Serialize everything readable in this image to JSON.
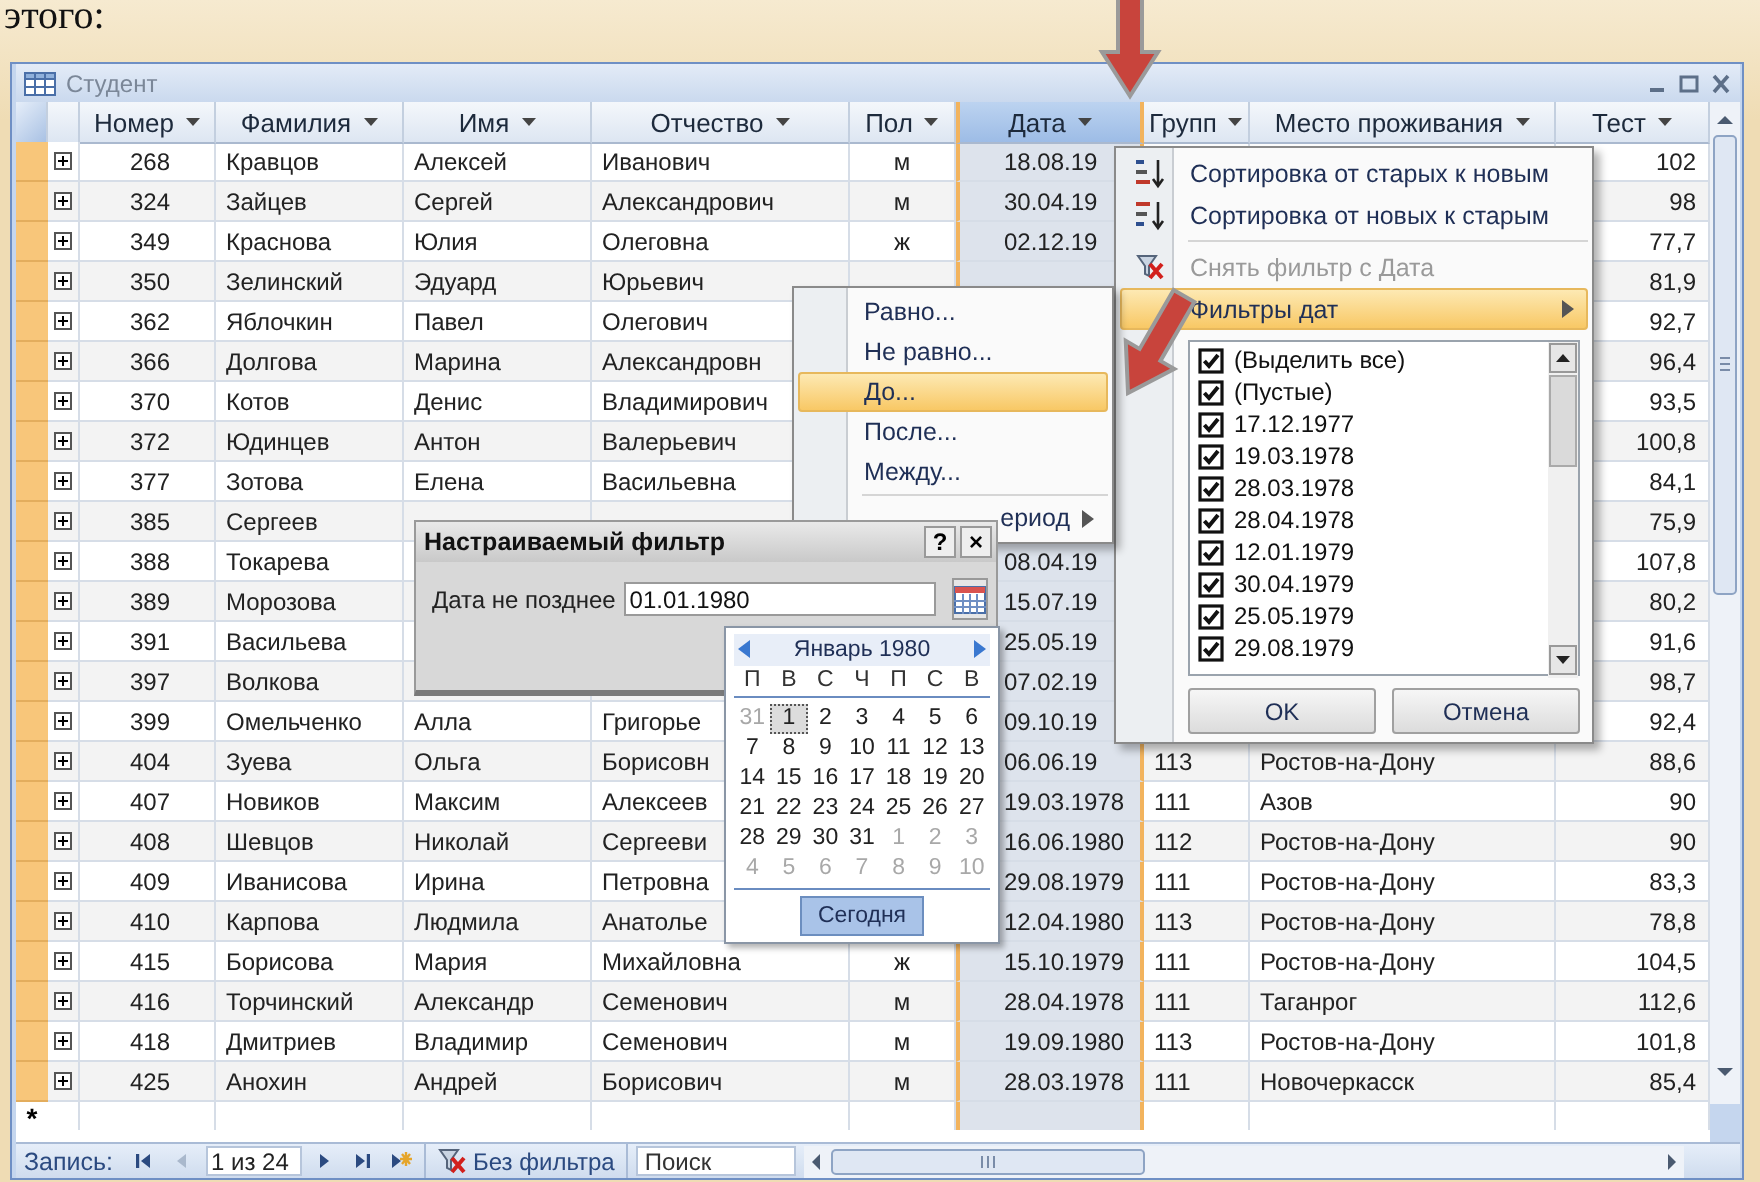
{
  "caption": "этого:",
  "window": {
    "title": "Студент"
  },
  "table": {
    "columns": [
      {
        "label": "Номер",
        "selected": false
      },
      {
        "label": "Фамилия",
        "selected": false
      },
      {
        "label": "Имя",
        "selected": false
      },
      {
        "label": "Отчество",
        "selected": false
      },
      {
        "label": "Пол",
        "selected": false
      },
      {
        "label": "Дата",
        "selected": true
      },
      {
        "label": "Групп",
        "selected": false
      },
      {
        "label": "Место проживания",
        "selected": false
      },
      {
        "label": "Тест",
        "selected": false
      }
    ],
    "rows": [
      {
        "cells": [
          "268",
          "Кравцов",
          "Алексей",
          "Иванович",
          "м",
          "18.08.19",
          null,
          null,
          "102"
        ]
      },
      {
        "cells": [
          "324",
          "Зайцев",
          "Сергей",
          "Александрович",
          "м",
          "30.04.19",
          null,
          null,
          "98"
        ]
      },
      {
        "cells": [
          "349",
          "Краснова",
          "Юлия",
          "Олеговна",
          "ж",
          "02.12.19",
          null,
          null,
          "77,7"
        ]
      },
      {
        "cells": [
          "350",
          "Зелинский",
          "Эдуард",
          "Юрьевич",
          null,
          null,
          null,
          null,
          "81,9"
        ]
      },
      {
        "cells": [
          "362",
          "Яблочкин",
          "Павел",
          "Олегович",
          null,
          null,
          null,
          null,
          "92,7"
        ]
      },
      {
        "cells": [
          "366",
          "Долгова",
          "Марина",
          "Александровн",
          null,
          null,
          null,
          null,
          "96,4"
        ]
      },
      {
        "cells": [
          "370",
          "Котов",
          "Денис",
          "Владимирович",
          null,
          null,
          null,
          null,
          "93,5"
        ]
      },
      {
        "cells": [
          "372",
          "Юдинцев",
          "Антон",
          "Валерьевич",
          null,
          null,
          null,
          null,
          "100,8"
        ]
      },
      {
        "cells": [
          "377",
          "Зотова",
          "Елена",
          "Васильевна",
          null,
          null,
          null,
          null,
          "84,1"
        ]
      },
      {
        "cells": [
          "385",
          "Сергеев",
          null,
          null,
          null,
          null,
          null,
          null,
          "75,9"
        ]
      },
      {
        "cells": [
          "388",
          "Токарева",
          null,
          null,
          null,
          "08.04.19",
          null,
          null,
          "107,8"
        ]
      },
      {
        "cells": [
          "389",
          "Морозова",
          null,
          null,
          null,
          "15.07.19",
          null,
          null,
          "80,2"
        ]
      },
      {
        "cells": [
          "391",
          "Васильева",
          null,
          null,
          null,
          "25.05.19",
          null,
          null,
          "91,6"
        ]
      },
      {
        "cells": [
          "397",
          "Волкова",
          null,
          null,
          null,
          "07.02.19",
          null,
          null,
          "98,7"
        ]
      },
      {
        "cells": [
          "399",
          "Омельченко",
          "Алла",
          "Григорье",
          null,
          "09.10.19",
          null,
          null,
          "92,4"
        ]
      },
      {
        "cells": [
          "404",
          "Зуева",
          "Ольга",
          "Борисовн",
          null,
          "06.06.19",
          "113",
          "Ростов-на-Дону",
          "88,6"
        ]
      },
      {
        "cells": [
          "407",
          "Новиков",
          "Максим",
          "Алексеев",
          null,
          "19.03.1978",
          "111",
          "Азов",
          "90"
        ]
      },
      {
        "cells": [
          "408",
          "Шевцов",
          "Николай",
          "Сергееви",
          null,
          "16.06.1980",
          "112",
          "Ростов-на-Дону",
          "90"
        ]
      },
      {
        "cells": [
          "409",
          "Иванисова",
          "Ирина",
          "Петровна",
          null,
          "29.08.1979",
          "111",
          "Ростов-на-Дону",
          "83,3"
        ]
      },
      {
        "cells": [
          "410",
          "Карпова",
          "Людмила",
          "Анатолье",
          null,
          "12.04.1980",
          "113",
          "Ростов-на-Дону",
          "78,8"
        ]
      },
      {
        "cells": [
          "415",
          "Борисова",
          "Мария",
          "Михайловна",
          "ж",
          "15.10.1979",
          "111",
          "Ростов-на-Дону",
          "104,5"
        ]
      },
      {
        "cells": [
          "416",
          "Торчинский",
          "Александр",
          "Семенович",
          "м",
          "28.04.1978",
          "111",
          "Таганрог",
          "112,6"
        ]
      },
      {
        "cells": [
          "418",
          "Дмитриев",
          "Владимир",
          "Семенович",
          "м",
          "19.09.1980",
          "113",
          "Ростов-на-Дону",
          "101,8"
        ]
      },
      {
        "cells": [
          "425",
          "Анохин",
          "Андрей",
          "Борисович",
          "м",
          "28.03.1978",
          "111",
          "Новочеркасск",
          "85,4"
        ]
      }
    ],
    "new_row_marker": "*"
  },
  "nav": {
    "label": "Запись:",
    "position": "1 из 24",
    "buttons": [
      {
        "kind": "first",
        "disabled": false
      },
      {
        "kind": "prev",
        "disabled": true
      },
      {
        "kind": "next",
        "disabled": false
      },
      {
        "kind": "last",
        "disabled": false
      },
      {
        "kind": "new",
        "disabled": false
      }
    ],
    "filter": "Без фильтра",
    "search": {
      "placeholder": "Поиск"
    }
  },
  "column_menu": {
    "items": [
      {
        "kind": "sort-asc",
        "label": "Сортировка от старых к новым",
        "disabled": false,
        "selected": false
      },
      {
        "kind": "sort-desc",
        "label": "Сортировка от новых к старым",
        "disabled": false,
        "selected": false
      },
      {
        "kind": "clear-filter",
        "label": "Снять фильтр с Дата",
        "disabled": true,
        "selected": false
      },
      {
        "kind": "submenu",
        "label": "Фильтры дат",
        "disabled": false,
        "selected": true
      }
    ],
    "values": [
      {
        "label": "(Выделить все)",
        "checked": true
      },
      {
        "label": "(Пустые)",
        "checked": true
      },
      {
        "label": "17.12.1977",
        "checked": true
      },
      {
        "label": "19.03.1978",
        "checked": true
      },
      {
        "label": "28.03.1978",
        "checked": true
      },
      {
        "label": "28.04.1978",
        "checked": true
      },
      {
        "label": "12.01.1979",
        "checked": true
      },
      {
        "label": "30.04.1979",
        "checked": true
      },
      {
        "label": "25.05.1979",
        "checked": true
      },
      {
        "label": "29.08.1979",
        "checked": true
      }
    ],
    "buttons": [
      "OK",
      "Отмена"
    ]
  },
  "date_filters_menu": {
    "items": [
      {
        "kind": "command",
        "label": "Равно...",
        "selected": false
      },
      {
        "kind": "command",
        "label": "Не равно...",
        "selected": false
      },
      {
        "kind": "command",
        "label": "До...",
        "selected": true
      },
      {
        "kind": "command",
        "label": "После...",
        "selected": false
      },
      {
        "kind": "command",
        "label": "Между...",
        "selected": false
      },
      {
        "kind": "submenu",
        "label": "ериод",
        "selected": false
      }
    ]
  },
  "dialog": {
    "title": "Настраиваемый фильтр",
    "title_buttons": [
      "?",
      "×"
    ],
    "label": "Дата не позднее",
    "value": "01.01.1980"
  },
  "calendar": {
    "month": "Январь 1980",
    "weekdays": [
      "П",
      "В",
      "С",
      "Ч",
      "П",
      "С",
      "В"
    ],
    "weeks": [
      [
        {
          "day": "31",
          "other_month": true,
          "selected": false
        },
        {
          "day": "1",
          "other_month": false,
          "selected": true
        },
        {
          "day": "2",
          "other_month": false,
          "selected": false
        },
        {
          "day": "3",
          "other_month": false,
          "selected": false
        },
        {
          "day": "4",
          "other_month": false,
          "selected": false
        },
        {
          "day": "5",
          "other_month": false,
          "selected": false
        },
        {
          "day": "6",
          "other_month": false,
          "selected": false
        }
      ],
      [
        {
          "day": "7",
          "other_month": false,
          "selected": false
        },
        {
          "day": "8",
          "other_month": false,
          "selected": false
        },
        {
          "day": "9",
          "other_month": false,
          "selected": false
        },
        {
          "day": "10",
          "other_month": false,
          "selected": false
        },
        {
          "day": "11",
          "other_month": false,
          "selected": false
        },
        {
          "day": "12",
          "other_month": false,
          "selected": false
        },
        {
          "day": "13",
          "other_month": false,
          "selected": false
        }
      ],
      [
        {
          "day": "14",
          "other_month": false,
          "selected": false
        },
        {
          "day": "15",
          "other_month": false,
          "selected": false
        },
        {
          "day": "16",
          "other_month": false,
          "selected": false
        },
        {
          "day": "17",
          "other_month": false,
          "selected": false
        },
        {
          "day": "18",
          "other_month": false,
          "selected": false
        },
        {
          "day": "19",
          "other_month": false,
          "selected": false
        },
        {
          "day": "20",
          "other_month": false,
          "selected": false
        }
      ],
      [
        {
          "day": "21",
          "other_month": false,
          "selected": false
        },
        {
          "day": "22",
          "other_month": false,
          "selected": false
        },
        {
          "day": "23",
          "other_month": false,
          "selected": false
        },
        {
          "day": "24",
          "other_month": false,
          "selected": false
        },
        {
          "day": "25",
          "other_month": false,
          "selected": false
        },
        {
          "day": "26",
          "other_month": false,
          "selected": false
        },
        {
          "day": "27",
          "other_month": false,
          "selected": false
        }
      ],
      [
        {
          "day": "28",
          "other_month": false,
          "selected": false
        },
        {
          "day": "29",
          "other_month": false,
          "selected": false
        },
        {
          "day": "30",
          "other_month": false,
          "selected": false
        },
        {
          "day": "31",
          "other_month": false,
          "selected": false
        },
        {
          "day": "1",
          "other_month": true,
          "selected": false
        },
        {
          "day": "2",
          "other_month": true,
          "selected": false
        },
        {
          "day": "3",
          "other_month": true,
          "selected": false
        }
      ],
      [
        {
          "day": "4",
          "other_month": true,
          "selected": false
        },
        {
          "day": "5",
          "other_month": true,
          "selected": false
        },
        {
          "day": "6",
          "other_month": true,
          "selected": false
        },
        {
          "day": "7",
          "other_month": true,
          "selected": false
        },
        {
          "day": "8",
          "other_month": true,
          "selected": false
        },
        {
          "day": "9",
          "other_month": true,
          "selected": false
        },
        {
          "day": "10",
          "other_month": true,
          "selected": false
        }
      ]
    ],
    "today_button": "Сегодня"
  }
}
